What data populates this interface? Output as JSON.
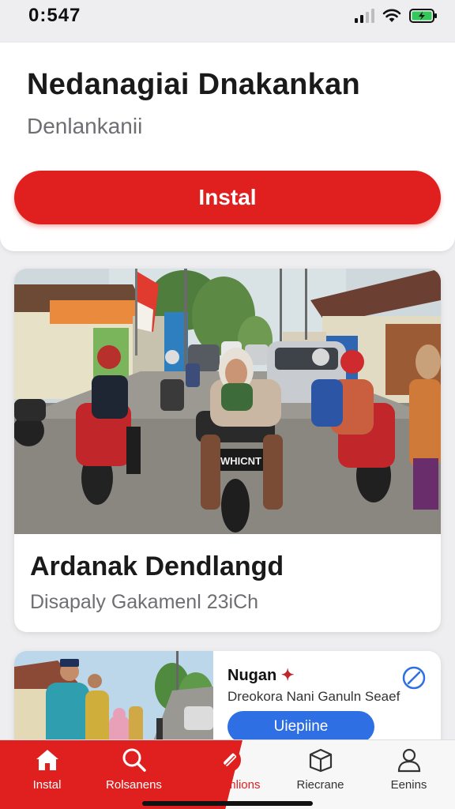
{
  "status_bar": {
    "time": "0:547"
  },
  "install_card": {
    "title": "Nedanagiai Dnakankan",
    "subtitle": "Denlankanii",
    "button_label": "Instal"
  },
  "feature_card": {
    "title": "Ardanak Dendlangd",
    "subtitle": "Disapaly Gakamenl 23iCh",
    "plate_text": "WHICNT"
  },
  "promo_card": {
    "title": "Nugan",
    "description": "Dreokora Nani Ganuln Seaef",
    "button_label": "Uiepiine"
  },
  "tab_bar": {
    "tabs": [
      {
        "label": "Instal",
        "icon": "home-icon"
      },
      {
        "label": "Rolsanens",
        "icon": "search-icon"
      },
      {
        "label": "Carmmlions",
        "icon": "tag-icon"
      },
      {
        "label": "Riecrane",
        "icon": "box-icon"
      },
      {
        "label": "Eenins",
        "icon": "person-icon"
      }
    ]
  },
  "colors": {
    "accent_red": "#e0201f",
    "accent_blue": "#2f6fe4",
    "background": "#eeeef0"
  }
}
